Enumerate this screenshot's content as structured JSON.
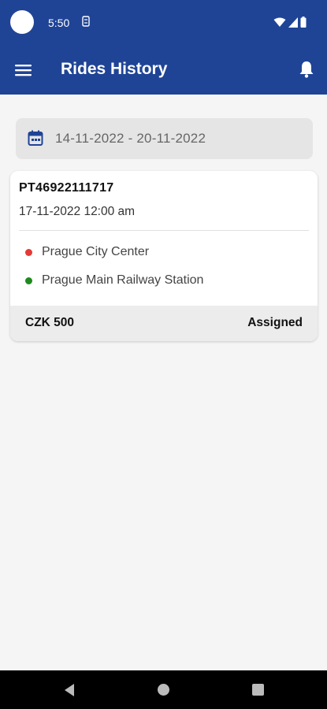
{
  "status_bar": {
    "time": "5:50"
  },
  "app_bar": {
    "title": "Rides History"
  },
  "date_filter": {
    "range": "14-11-2022 - 20-11-2022"
  },
  "rides": [
    {
      "id": "PT46922111717",
      "datetime": "17-11-2022 12:00 am",
      "pickup": "Prague City Center",
      "dropoff": "Prague Main Railway Station",
      "fare": "CZK 500",
      "status": "Assigned"
    }
  ],
  "colors": {
    "primary": "#1f4496",
    "pickup_dot": "#e53935",
    "dropoff_dot": "#1e8a1e",
    "background": "#f5f5f5"
  },
  "icons": {
    "menu": "hamburger-icon",
    "notifications": "bell-icon",
    "calendar": "calendar-icon"
  }
}
